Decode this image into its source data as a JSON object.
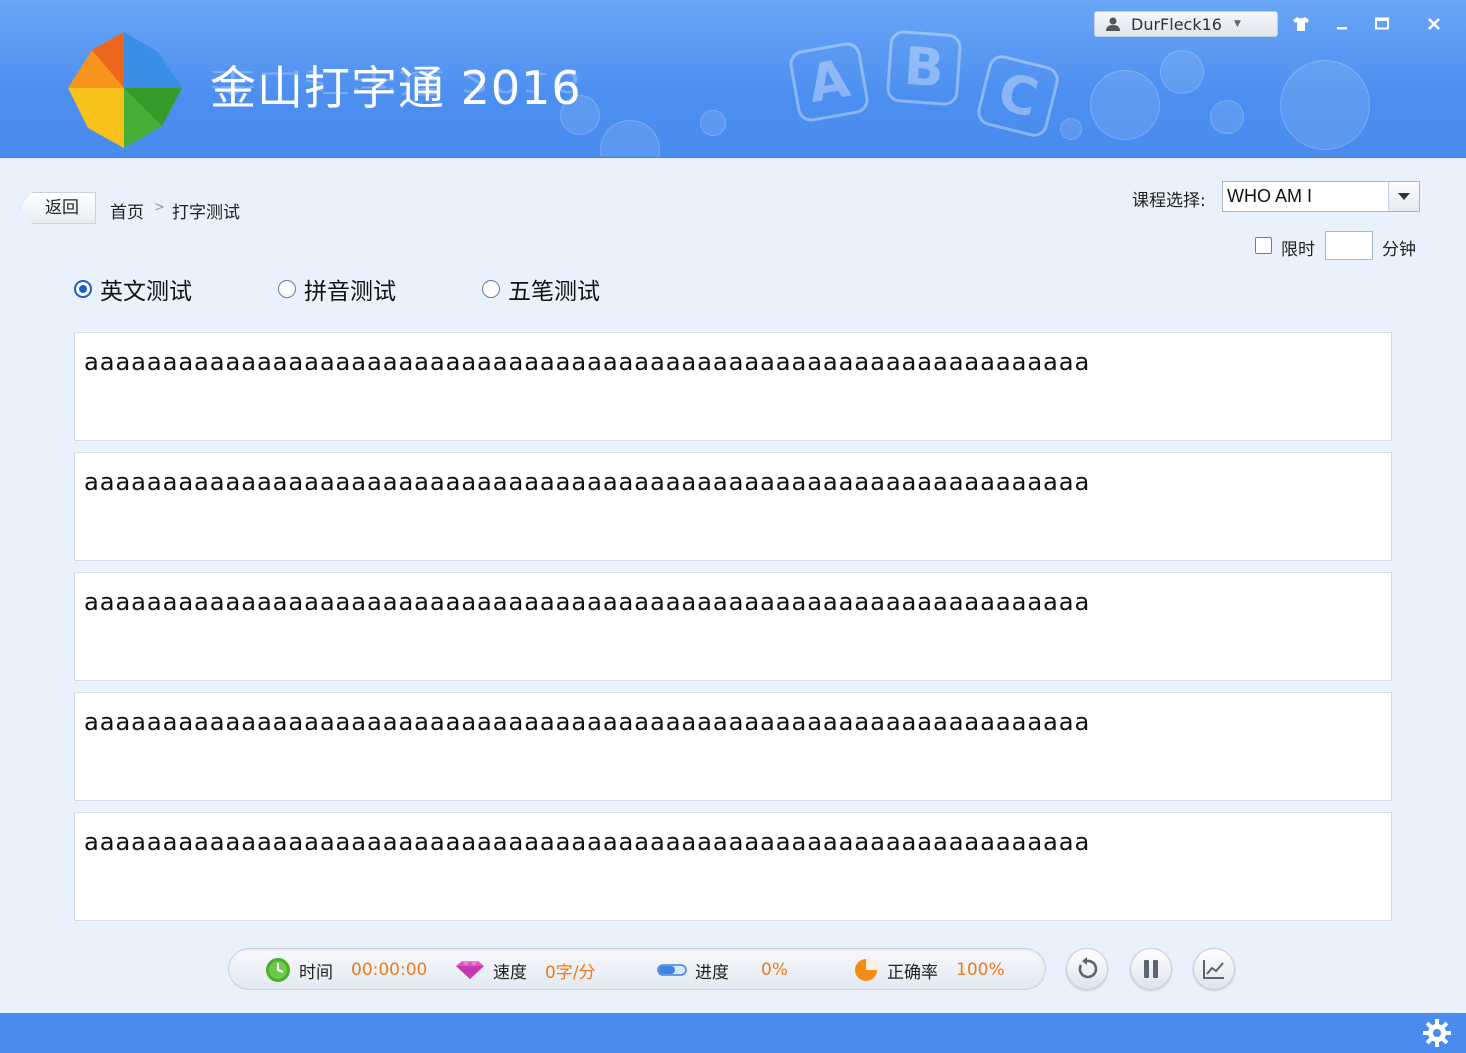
{
  "app": {
    "title": "金山打字通 2016",
    "user": "DurFleck16",
    "logo_blocks": [
      "A",
      "B",
      "C"
    ]
  },
  "window_controls": {
    "skin_icon": "shirt-icon",
    "minimize_icon": "minimize-icon",
    "maximize_icon": "maximize-icon",
    "close_icon": "close-icon"
  },
  "nav": {
    "back_label": "返回",
    "breadcrumb": [
      "首页",
      "打字测试"
    ],
    "separator": ">"
  },
  "course": {
    "label": "课程选择:",
    "selected": "WHO AM I"
  },
  "time_limit": {
    "checkbox_label": "限时",
    "checked": false,
    "value": "",
    "unit": "分钟"
  },
  "test_modes": [
    {
      "label": "英文测试",
      "selected": true
    },
    {
      "label": "拼音测试",
      "selected": false
    },
    {
      "label": "五笔测试",
      "selected": false
    }
  ],
  "text_lines": [
    "aaaaaaaaaaaaaaaaaaaaaaaaaaaaaaaaaaaaaaaaaaaaaaaaaaaaaaaaaaaaaaaa",
    "aaaaaaaaaaaaaaaaaaaaaaaaaaaaaaaaaaaaaaaaaaaaaaaaaaaaaaaaaaaaaaaa",
    "aaaaaaaaaaaaaaaaaaaaaaaaaaaaaaaaaaaaaaaaaaaaaaaaaaaaaaaaaaaaaaaa",
    "aaaaaaaaaaaaaaaaaaaaaaaaaaaaaaaaaaaaaaaaaaaaaaaaaaaaaaaaaaaaaaaa",
    "aaaaaaaaaaaaaaaaaaaaaaaaaaaaaaaaaaaaaaaaaaaaaaaaaaaaaaaaaaaaaaaa"
  ],
  "stats": {
    "time": {
      "label": "时间",
      "value": "00:00:00",
      "icon": "clock-icon"
    },
    "speed": {
      "label": "速度",
      "value": "0字/分",
      "icon": "gem-icon"
    },
    "progress": {
      "label": "进度",
      "value": "0%",
      "icon": "progress-icon"
    },
    "accuracy": {
      "label": "正确率",
      "value": "100%",
      "icon": "pie-icon"
    }
  },
  "controls": {
    "restart_icon": "restart-icon",
    "pause_icon": "pause-icon",
    "chart_icon": "chart-icon"
  },
  "footer": {
    "settings_icon": "gear-icon"
  },
  "colors": {
    "header_blue": "#4d8ff0",
    "footer_blue": "#4a8cee",
    "stat_value_orange": "#f07a1a",
    "radio_blue": "#1a5fc9"
  }
}
